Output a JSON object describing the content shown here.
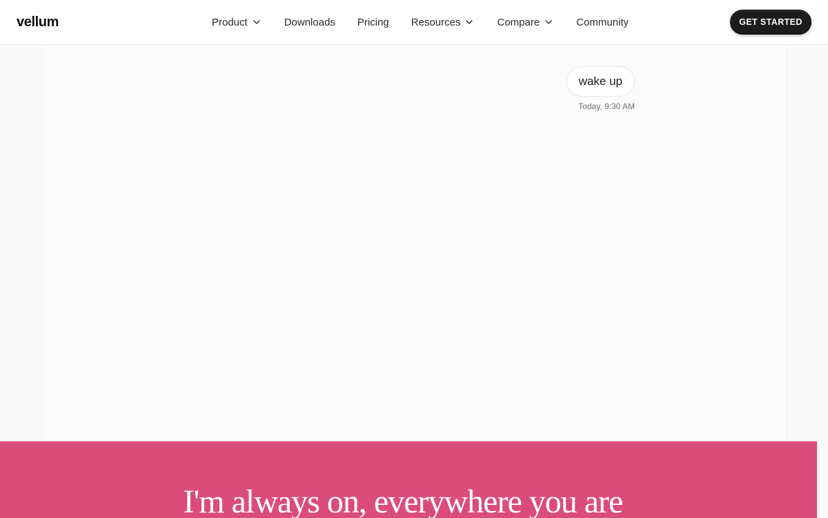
{
  "brand": {
    "logo_text": "vellum"
  },
  "nav": {
    "items": [
      {
        "label": "Product",
        "has_dropdown": true
      },
      {
        "label": "Downloads",
        "has_dropdown": false
      },
      {
        "label": "Pricing",
        "has_dropdown": false
      },
      {
        "label": "Resources",
        "has_dropdown": true
      },
      {
        "label": "Compare",
        "has_dropdown": true
      },
      {
        "label": "Community",
        "has_dropdown": false
      }
    ],
    "cta_label": "GET STARTED"
  },
  "chat": {
    "message": "wake up",
    "timestamp": "Today, 9:30 AM"
  },
  "hero": {
    "title": "I'm always on, everywhere you are",
    "background_color": "#db4c7b"
  },
  "icons": {
    "dropdown": "chevron-down-icon"
  }
}
